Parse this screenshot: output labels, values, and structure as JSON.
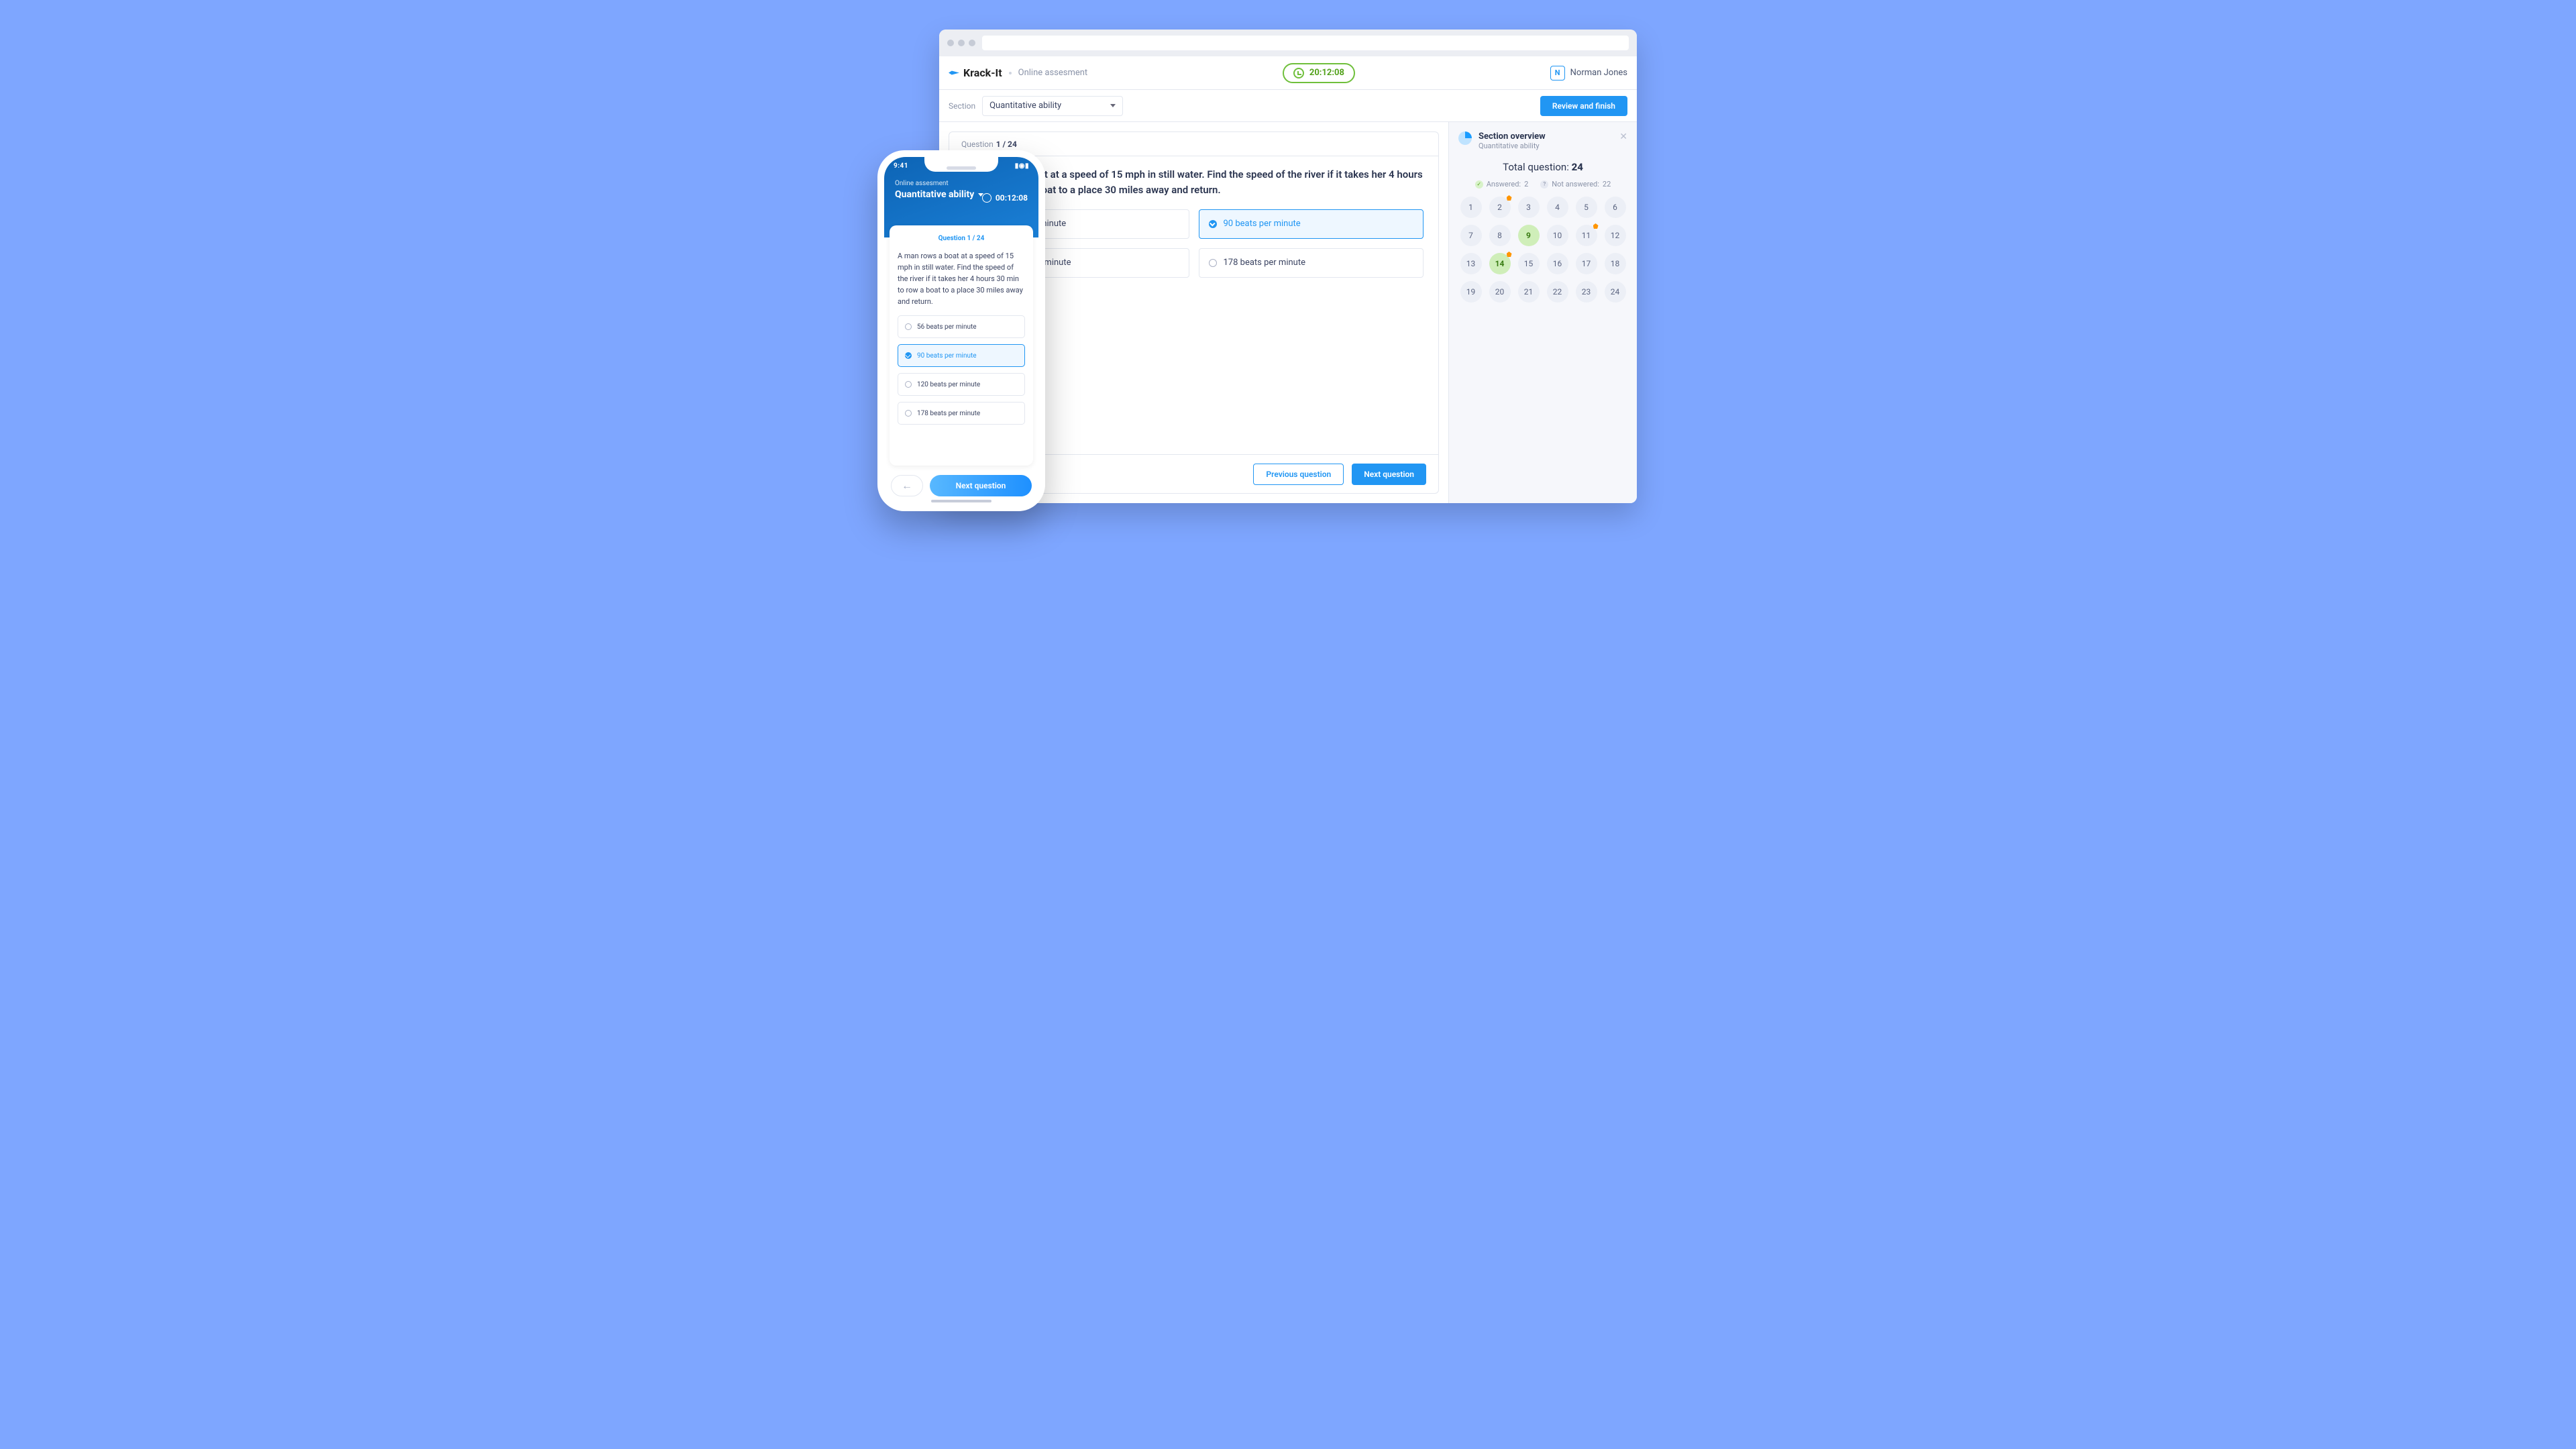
{
  "header": {
    "brand": "Krack-It",
    "subtitle": "Online assesment",
    "timer": "20:12:08",
    "user_initial": "N",
    "user_name": "Norman Jones"
  },
  "toolbar": {
    "section_label": "Section",
    "section_value": "Quantitative ability",
    "review_btn": "Review and finish"
  },
  "question": {
    "label": "Question",
    "counter": "1 / 24",
    "text": "A man rows a boat at a speed of 15 mph in still water. Find the speed of the river if it takes her 4 hours 30 min to row a boat to a place 30 miles away and return.",
    "options": [
      "56 beats per minute",
      "90 beats per minute",
      "120 beats per minute",
      "178 beats per minute"
    ],
    "selected_index": 1,
    "prev_btn": "Previous question",
    "next_btn": "Next question"
  },
  "overview": {
    "title": "Section overview",
    "subtitle": "Quantitative ability",
    "total_label": "Total question:",
    "total": "24",
    "answered_label": "Answered:",
    "answered": "2",
    "not_label": "Not answered:",
    "not": "22",
    "cells": [
      {
        "n": 1
      },
      {
        "n": 2,
        "flag": true
      },
      {
        "n": 3
      },
      {
        "n": 4
      },
      {
        "n": 5
      },
      {
        "n": 6
      },
      {
        "n": 7
      },
      {
        "n": 8
      },
      {
        "n": 9,
        "answered": true
      },
      {
        "n": 10
      },
      {
        "n": 11,
        "flag": true
      },
      {
        "n": 12
      },
      {
        "n": 13
      },
      {
        "n": 14,
        "answered": true,
        "flag": true
      },
      {
        "n": 15
      },
      {
        "n": 16
      },
      {
        "n": 17
      },
      {
        "n": 18
      },
      {
        "n": 19
      },
      {
        "n": 20
      },
      {
        "n": 21
      },
      {
        "n": 22
      },
      {
        "n": 23
      },
      {
        "n": 24
      }
    ]
  },
  "phone": {
    "clock": "9:41",
    "subtitle": "Online assesment",
    "section": "Quantitative ability",
    "timer": "00:12:08",
    "qheader": "Question 1 / 24",
    "qtext": "A man rows a boat at a speed of 15 mph in still water. Find the speed of the river if it takes her 4 hours 30 min to row a boat to a place 30 miles away and return.",
    "options": [
      "56 beats per minute",
      "90 beats per minute",
      "120 beats per minute",
      "178 beats per minute"
    ],
    "selected_index": 1,
    "next_btn": "Next question"
  }
}
